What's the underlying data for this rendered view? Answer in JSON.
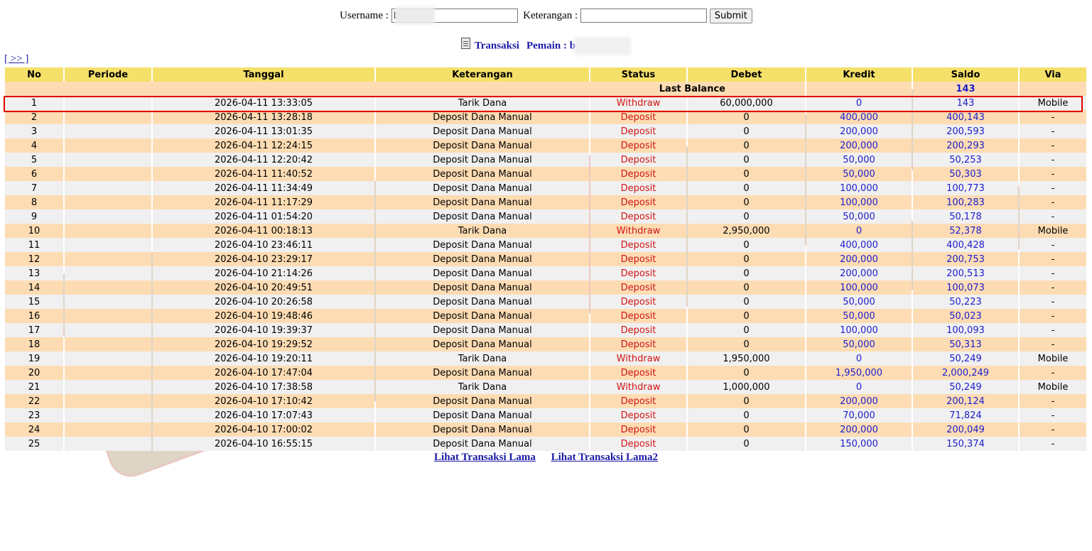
{
  "form": {
    "username_label": "Username :",
    "username_value": "b",
    "keterangan_label": "Keterangan :",
    "keterangan_value": "",
    "submit_label": "Submit"
  },
  "heading": {
    "transaksi_label": "Transaksi",
    "pemain_label": "Pemain : b"
  },
  "nav": {
    "next_label": "[ >> ]"
  },
  "table": {
    "headers": [
      "No",
      "Periode",
      "Tanggal",
      "Keterangan",
      "Status",
      "Debet",
      "Kredit",
      "Saldo",
      "Via"
    ],
    "last_balance_label": "Last Balance",
    "last_balance_value": "143",
    "rows": [
      {
        "no": "1",
        "periode": "",
        "tanggal": "2026-04-11 13:33:05",
        "keterangan": "Tarik Dana",
        "status": "Withdraw",
        "debet": "60,000,000",
        "kredit": "0",
        "saldo": "143",
        "via": "Mobile"
      },
      {
        "no": "2",
        "periode": "",
        "tanggal": "2026-04-11 13:28:18",
        "keterangan": "Deposit Dana Manual",
        "status": "Deposit",
        "debet": "0",
        "kredit": "400,000",
        "saldo": "400,143",
        "via": "-"
      },
      {
        "no": "3",
        "periode": "",
        "tanggal": "2026-04-11 13:01:35",
        "keterangan": "Deposit Dana Manual",
        "status": "Deposit",
        "debet": "0",
        "kredit": "200,000",
        "saldo": "200,593",
        "via": "-"
      },
      {
        "no": "4",
        "periode": "",
        "tanggal": "2026-04-11 12:24:15",
        "keterangan": "Deposit Dana Manual",
        "status": "Deposit",
        "debet": "0",
        "kredit": "200,000",
        "saldo": "200,293",
        "via": "-"
      },
      {
        "no": "5",
        "periode": "",
        "tanggal": "2026-04-11 12:20:42",
        "keterangan": "Deposit Dana Manual",
        "status": "Deposit",
        "debet": "0",
        "kredit": "50,000",
        "saldo": "50,253",
        "via": "-"
      },
      {
        "no": "6",
        "periode": "",
        "tanggal": "2026-04-11 11:40:52",
        "keterangan": "Deposit Dana Manual",
        "status": "Deposit",
        "debet": "0",
        "kredit": "50,000",
        "saldo": "50,303",
        "via": "-"
      },
      {
        "no": "7",
        "periode": "",
        "tanggal": "2026-04-11 11:34:49",
        "keterangan": "Deposit Dana Manual",
        "status": "Deposit",
        "debet": "0",
        "kredit": "100,000",
        "saldo": "100,773",
        "via": "-"
      },
      {
        "no": "8",
        "periode": "",
        "tanggal": "2026-04-11 11:17:29",
        "keterangan": "Deposit Dana Manual",
        "status": "Deposit",
        "debet": "0",
        "kredit": "100,000",
        "saldo": "100,283",
        "via": "-"
      },
      {
        "no": "9",
        "periode": "",
        "tanggal": "2026-04-11 01:54:20",
        "keterangan": "Deposit Dana Manual",
        "status": "Deposit",
        "debet": "0",
        "kredit": "50,000",
        "saldo": "50,178",
        "via": "-"
      },
      {
        "no": "10",
        "periode": "",
        "tanggal": "2026-04-11 00:18:13",
        "keterangan": "Tarik Dana",
        "status": "Withdraw",
        "debet": "2,950,000",
        "kredit": "0",
        "saldo": "52,378",
        "via": "Mobile"
      },
      {
        "no": "11",
        "periode": "",
        "tanggal": "2026-04-10 23:46:11",
        "keterangan": "Deposit Dana Manual",
        "status": "Deposit",
        "debet": "0",
        "kredit": "400,000",
        "saldo": "400,428",
        "via": "-"
      },
      {
        "no": "12",
        "periode": "",
        "tanggal": "2026-04-10 23:29:17",
        "keterangan": "Deposit Dana Manual",
        "status": "Deposit",
        "debet": "0",
        "kredit": "200,000",
        "saldo": "200,753",
        "via": "-"
      },
      {
        "no": "13",
        "periode": "",
        "tanggal": "2026-04-10 21:14:26",
        "keterangan": "Deposit Dana Manual",
        "status": "Deposit",
        "debet": "0",
        "kredit": "200,000",
        "saldo": "200,513",
        "via": "-"
      },
      {
        "no": "14",
        "periode": "",
        "tanggal": "2026-04-10 20:49:51",
        "keterangan": "Deposit Dana Manual",
        "status": "Deposit",
        "debet": "0",
        "kredit": "100,000",
        "saldo": "100,073",
        "via": "-"
      },
      {
        "no": "15",
        "periode": "",
        "tanggal": "2026-04-10 20:26:58",
        "keterangan": "Deposit Dana Manual",
        "status": "Deposit",
        "debet": "0",
        "kredit": "50,000",
        "saldo": "50,223",
        "via": "-"
      },
      {
        "no": "16",
        "periode": "",
        "tanggal": "2026-04-10 19:48:46",
        "keterangan": "Deposit Dana Manual",
        "status": "Deposit",
        "debet": "0",
        "kredit": "50,000",
        "saldo": "50,023",
        "via": "-"
      },
      {
        "no": "17",
        "periode": "",
        "tanggal": "2026-04-10 19:39:37",
        "keterangan": "Deposit Dana Manual",
        "status": "Deposit",
        "debet": "0",
        "kredit": "100,000",
        "saldo": "100,093",
        "via": "-"
      },
      {
        "no": "18",
        "periode": "",
        "tanggal": "2026-04-10 19:29:52",
        "keterangan": "Deposit Dana Manual",
        "status": "Deposit",
        "debet": "0",
        "kredit": "50,000",
        "saldo": "50,313",
        "via": "-"
      },
      {
        "no": "19",
        "periode": "",
        "tanggal": "2026-04-10 19:20:11",
        "keterangan": "Tarik Dana",
        "status": "Withdraw",
        "debet": "1,950,000",
        "kredit": "0",
        "saldo": "50,249",
        "via": "Mobile"
      },
      {
        "no": "20",
        "periode": "",
        "tanggal": "2026-04-10 17:47:04",
        "keterangan": "Deposit Dana Manual",
        "status": "Deposit",
        "debet": "0",
        "kredit": "1,950,000",
        "saldo": "2,000,249",
        "via": "-"
      },
      {
        "no": "21",
        "periode": "",
        "tanggal": "2026-04-10 17:38:58",
        "keterangan": "Tarik Dana",
        "status": "Withdraw",
        "debet": "1,000,000",
        "kredit": "0",
        "saldo": "50,249",
        "via": "Mobile"
      },
      {
        "no": "22",
        "periode": "",
        "tanggal": "2026-04-10 17:10:42",
        "keterangan": "Deposit Dana Manual",
        "status": "Deposit",
        "debet": "0",
        "kredit": "200,000",
        "saldo": "200,124",
        "via": "-"
      },
      {
        "no": "23",
        "periode": "",
        "tanggal": "2026-04-10 17:07:43",
        "keterangan": "Deposit Dana Manual",
        "status": "Deposit",
        "debet": "0",
        "kredit": "70,000",
        "saldo": "71,824",
        "via": "-"
      },
      {
        "no": "24",
        "periode": "",
        "tanggal": "2026-04-10 17:00:02",
        "keterangan": "Deposit Dana Manual",
        "status": "Deposit",
        "debet": "0",
        "kredit": "200,000",
        "saldo": "200,049",
        "via": "-"
      },
      {
        "no": "25",
        "periode": "",
        "tanggal": "2026-04-10 16:55:15",
        "keterangan": "Deposit Dana Manual",
        "status": "Deposit",
        "debet": "0",
        "kredit": "150,000",
        "saldo": "150,374",
        "via": "-"
      }
    ]
  },
  "footer": {
    "link_old": "Lihat Transaksi Lama",
    "link_old2": "Lihat Transaksi Lama2"
  },
  "colors": {
    "header_bg": "#f5e06a",
    "row_odd": "#f0f0f0",
    "row_even": "#fddcb3",
    "status_red": "#d11414",
    "value_blue": "#1d1dcc",
    "highlight_border": "#e00000"
  },
  "icons": {
    "heading_icon": "document-icon",
    "watermark": "watermark-logo"
  }
}
